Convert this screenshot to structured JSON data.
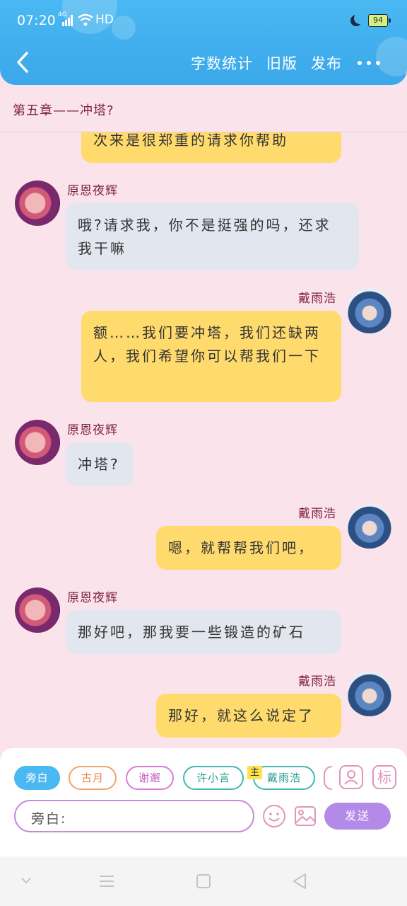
{
  "status_bar": {
    "time": "07:20",
    "network": "4G",
    "hd": "HD",
    "battery": "94"
  },
  "header": {
    "word_count": "字数统计",
    "old_version": "旧版",
    "publish": "发布"
  },
  "chapter_title": "第五章——冲塔?",
  "messages": [
    {
      "side": "right",
      "name": "",
      "text": "次来是很郑重的请求你帮助"
    },
    {
      "side": "left",
      "name": "原恩夜辉",
      "text": "哦?请求我，你不是挺强的吗，还求我干嘛"
    },
    {
      "side": "right",
      "name": "戴雨浩",
      "text": "额……我们要冲塔，我们还缺两人，我们希望你可以帮我们一下"
    },
    {
      "side": "left",
      "name": "原恩夜辉",
      "text": "冲塔?"
    },
    {
      "side": "right",
      "name": "戴雨浩",
      "text": "嗯，就帮帮我们吧，"
    },
    {
      "side": "left",
      "name": "原恩夜辉",
      "text": "那好吧，那我要一些锻造的矿石"
    },
    {
      "side": "right",
      "name": "戴雨浩",
      "text": "那好，就这么说定了"
    }
  ],
  "composer": {
    "roles": [
      {
        "label": "旁白",
        "color": "#4ab8f2"
      },
      {
        "label": "古月",
        "color": "#f0a36c"
      },
      {
        "label": "谢邂",
        "color": "#d87ad8"
      },
      {
        "label": "许小言",
        "color": "#3fb8b0"
      },
      {
        "label": "戴雨浩",
        "color": "#3fb8b0"
      }
    ],
    "main_tag": "主",
    "mark_label": "标",
    "input_label": "旁白:",
    "send_label": "发送"
  },
  "colors": {
    "header": "#3aa8ea",
    "background": "#fbe3ec",
    "bubble_right": "#ffdb6d",
    "bubble_left": "#e2e6ee",
    "name": "#7d1f3f"
  }
}
